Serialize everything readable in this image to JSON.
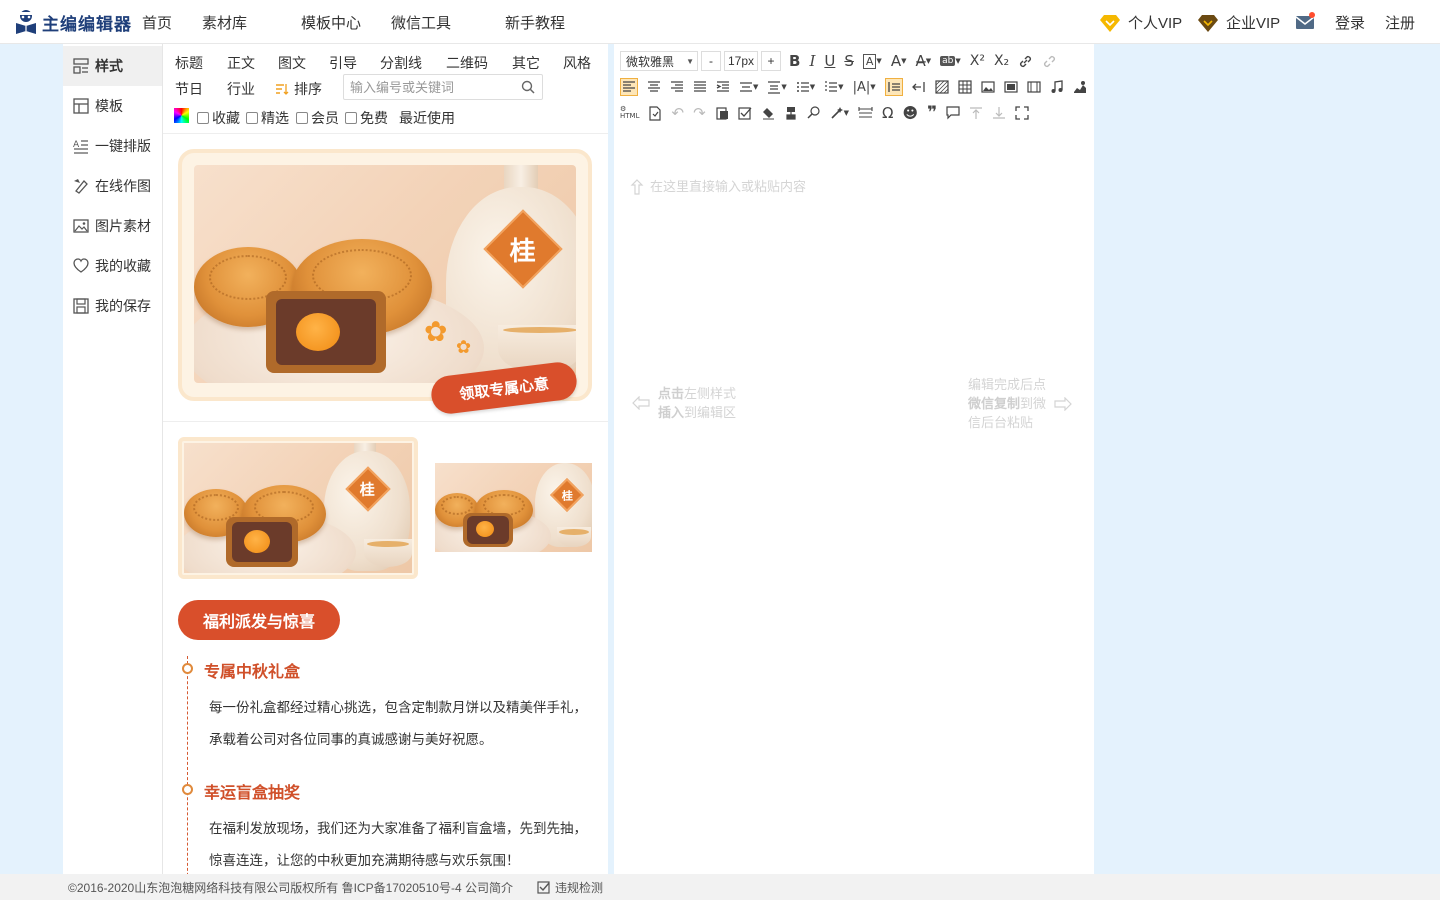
{
  "brand": {
    "name": "主编编辑器"
  },
  "nav": {
    "home": "首页",
    "materials": "素材库",
    "templates": "模板中心",
    "wechat_tools": "微信工具",
    "tutorial": "新手教程",
    "personal_vip": "个人VIP",
    "enterprise_vip": "企业VIP",
    "login": "登录",
    "register": "注册"
  },
  "side_menu": [
    {
      "label": "样式",
      "icon": "style-icon",
      "active": true
    },
    {
      "label": "模板",
      "icon": "template-icon"
    },
    {
      "label": "一键排版",
      "icon": "auto-layout-icon"
    },
    {
      "label": "在线作图",
      "icon": "online-design-icon"
    },
    {
      "label": "图片素材",
      "icon": "image-icon"
    },
    {
      "label": "我的收藏",
      "icon": "heart-icon"
    },
    {
      "label": "我的保存",
      "icon": "save-icon"
    }
  ],
  "categories": {
    "row1": [
      "标题",
      "正文",
      "图文",
      "引导",
      "分割线",
      "二维码",
      "其它",
      "风格"
    ],
    "row2": [
      "节日",
      "行业"
    ],
    "sort": "排序",
    "search_placeholder": "输入编号或关键词"
  },
  "filters": {
    "favorite": "收藏",
    "featured": "精选",
    "member": "会员",
    "free": "免费",
    "recent": "最近使用"
  },
  "preview": {
    "vase_char": "桂",
    "ribbon": "领取专属心意",
    "welfare_title": "福利派发与惊喜",
    "items": [
      {
        "title": "专属中秋礼盒",
        "lines": [
          "每一份礼盒都经过精心挑选，包含定制款月饼以及精美伴手礼，",
          "承载着公司对各位同事的真诚感谢与美好祝愿。"
        ]
      },
      {
        "title": "幸运盲盒抽奖",
        "lines": [
          "在福利发放现场，我们还为大家准备了福利盲盒墙，先到先抽，",
          "惊喜连连，让您的中秋更加充满期待感与欢乐氛围！"
        ]
      }
    ]
  },
  "editor": {
    "font": "微软雅黑",
    "size_minus": "-",
    "font_size": "17px",
    "size_plus": "+",
    "placeholder": "在这里直接输入或粘贴内容",
    "hint_left": {
      "line1_bold": "点击",
      "line1": "左侧样式",
      "line2_bold": "插入",
      "line2": "到编辑区"
    },
    "hint_right": {
      "line1": "编辑完成后点",
      "line2_bold": "微信复制",
      "line2": "到微",
      "line3": "信后台粘贴"
    }
  },
  "footer": {
    "copyright": "©2016-2020山东泡泡糖网络科技有限公司版权所有 鲁ICP备17020510号-4 公司简介",
    "check": "违规检测"
  },
  "colors": {
    "accent": "#d94f2b",
    "brand": "#1f3f7a",
    "vip_gold": "#f5b800",
    "vip_dark": "#6b4a12"
  }
}
